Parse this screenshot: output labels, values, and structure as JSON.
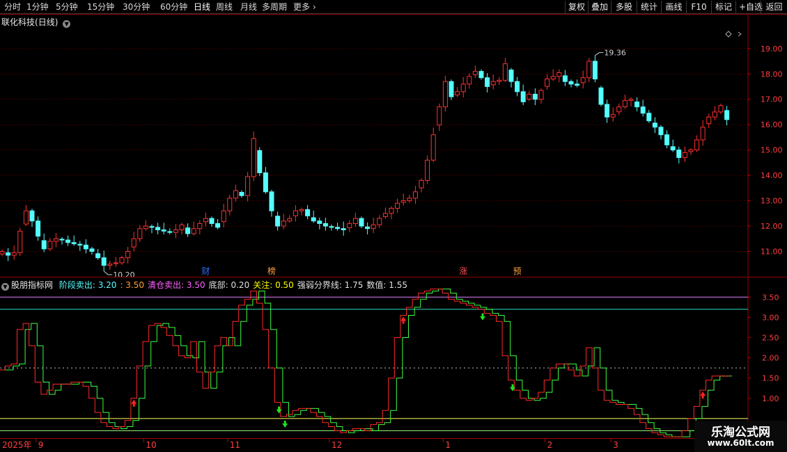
{
  "toolbar": {
    "periods": [
      "分时",
      "1分钟",
      "5分钟",
      "15分钟",
      "30分钟",
      "60分钟",
      "日线",
      "周线",
      "月线",
      "多周期",
      "更多"
    ],
    "active_period": "日线",
    "right_buttons": [
      "复权",
      "叠加",
      "多股",
      "统计",
      "画线",
      "F10",
      "标记",
      "+自选",
      "返回"
    ]
  },
  "main_chart": {
    "stock_name": "联化科技",
    "period_label": "(日线)",
    "high_label": "19.36",
    "low_label": "10.20",
    "event_markers": [
      "财",
      "榜",
      "涨",
      "预"
    ],
    "colors": {
      "up": "#ff3232",
      "down": "#54ffff",
      "grid": "#7a0000"
    }
  },
  "indicator": {
    "name": "股朋指标网",
    "items": [
      {
        "label": "阶段卖出:",
        "value": "3.20",
        "color": "#54ffff"
      },
      {
        "label": ":",
        "value": "3.50",
        "color": "#ff9f40"
      },
      {
        "label": "清仓卖出:",
        "value": "3.50",
        "color": "#ff60ff"
      },
      {
        "label": "底部:",
        "value": "0.20",
        "color": "#e0e0e0"
      },
      {
        "label": "关注:",
        "value": "0.50",
        "color": "#ffff00"
      },
      {
        "label": "强弱分界线:",
        "value": "1.75",
        "color": "#e0e0e0"
      },
      {
        "label": "数值:",
        "value": "1.55",
        "color": "#e0e0e0"
      }
    ]
  },
  "time_axis": {
    "year_label": "2025年",
    "month_labels": [
      "9",
      "10",
      "11",
      "12",
      "1",
      "2",
      "3"
    ]
  },
  "watermark": {
    "line1": "乐淘公式网",
    "line2": "www.60lt.com"
  },
  "chart_data": [
    {
      "type": "candlestick",
      "title": "联化科技(日线)",
      "ylim": [
        10.0,
        19.9
      ],
      "y_ticks": [
        "19.00",
        "18.00",
        "17.00",
        "16.00",
        "15.00",
        "14.00",
        "13.00",
        "12.00",
        "11.00"
      ],
      "close": [
        11.0,
        10.85,
        10.95,
        11.8,
        12.6,
        12.2,
        11.6,
        11.1,
        11.4,
        11.5,
        11.45,
        11.35,
        11.3,
        11.25,
        11.1,
        11.0,
        10.75,
        10.45,
        10.5,
        10.55,
        10.75,
        11.0,
        11.5,
        11.9,
        12.0,
        11.95,
        11.85,
        11.8,
        11.75,
        11.85,
        12.05,
        11.7,
        11.9,
        12.1,
        12.3,
        12.1,
        11.95,
        12.6,
        13.1,
        13.4,
        13.2,
        13.95,
        15.45,
        14.1,
        13.35,
        12.6,
        12.0,
        12.2,
        12.3,
        12.6,
        12.65,
        12.4,
        12.2,
        12.1,
        12.0,
        11.95,
        11.9,
        11.85,
        12.1,
        12.3,
        12.0,
        11.9,
        12.05,
        12.3,
        12.5,
        12.7,
        12.9,
        13.0,
        13.1,
        13.35,
        13.8,
        14.6,
        15.6,
        16.7,
        17.7,
        17.1,
        17.3,
        17.6,
        17.9,
        18.1,
        17.85,
        17.5,
        17.7,
        17.75,
        18.4,
        17.7,
        17.3,
        16.9,
        17.2,
        17.0,
        17.35,
        17.8,
        17.9,
        18.05,
        17.7,
        17.6,
        17.55,
        17.85,
        18.5,
        17.8,
        16.8,
        16.3,
        16.4,
        16.7,
        16.95,
        17.0,
        16.7,
        16.45,
        16.15,
        15.9,
        15.6,
        15.2,
        15.0,
        14.7,
        14.9,
        15.0,
        15.4,
        15.9,
        16.3,
        16.5,
        16.75,
        16.2
      ],
      "high_label": "19.36",
      "low_label": "10.20"
    },
    {
      "type": "line",
      "title": "股朋指标网",
      "ylim": [
        0.0,
        3.9
      ],
      "y_ticks": [
        "3.50",
        "3.00",
        "2.50",
        "2.00",
        "1.50",
        "1.00"
      ],
      "series": [
        {
          "name": "数值",
          "values": [
            1.7,
            1.8,
            1.85,
            2.7,
            2.85,
            2.3,
            1.4,
            1.1,
            1.2,
            1.35,
            1.35,
            1.35,
            1.4,
            1.4,
            1.3,
            1.0,
            0.65,
            0.4,
            0.3,
            0.25,
            0.3,
            0.45,
            1.0,
            1.8,
            2.4,
            2.8,
            2.85,
            2.75,
            2.55,
            2.3,
            2.05,
            2.0,
            2.4,
            1.65,
            1.25,
            1.65,
            2.3,
            2.5,
            2.3,
            2.9,
            3.3,
            3.45,
            3.65,
            3.35,
            2.7,
            1.75,
            0.9,
            0.55,
            0.6,
            0.7,
            0.75,
            0.75,
            0.65,
            0.55,
            0.4,
            0.3,
            0.2,
            0.15,
            0.2,
            0.25,
            0.25,
            0.2,
            0.35,
            0.4,
            0.7,
            1.5,
            2.5,
            3.05,
            3.25,
            3.45,
            3.6,
            3.65,
            3.7,
            3.7,
            3.6,
            3.45,
            3.4,
            3.35,
            3.3,
            3.25,
            3.2,
            3.1,
            3.05,
            2.9,
            2.05,
            1.45,
            1.2,
            1.0,
            0.95,
            1.0,
            1.15,
            1.45,
            1.75,
            1.85,
            1.85,
            1.7,
            1.55,
            1.8,
            2.25,
            1.75,
            1.2,
            0.95,
            0.9,
            0.85,
            0.85,
            0.75,
            0.6,
            0.4,
            0.25,
            0.15,
            0.1,
            0.05,
            0.05,
            0.05,
            0.2,
            0.5,
            0.8,
            1.2,
            1.45,
            1.55,
            1.55,
            1.55
          ]
        },
        {
          "name": "阶段卖出",
          "values": [
            3.2
          ]
        },
        {
          "name": "清仓卖出",
          "values": [
            3.5
          ]
        },
        {
          "name": "底部",
          "values": [
            0.2
          ]
        },
        {
          "name": "关注",
          "values": [
            0.5
          ]
        },
        {
          "name": "强弱分界线",
          "values": [
            1.75
          ]
        }
      ]
    }
  ]
}
